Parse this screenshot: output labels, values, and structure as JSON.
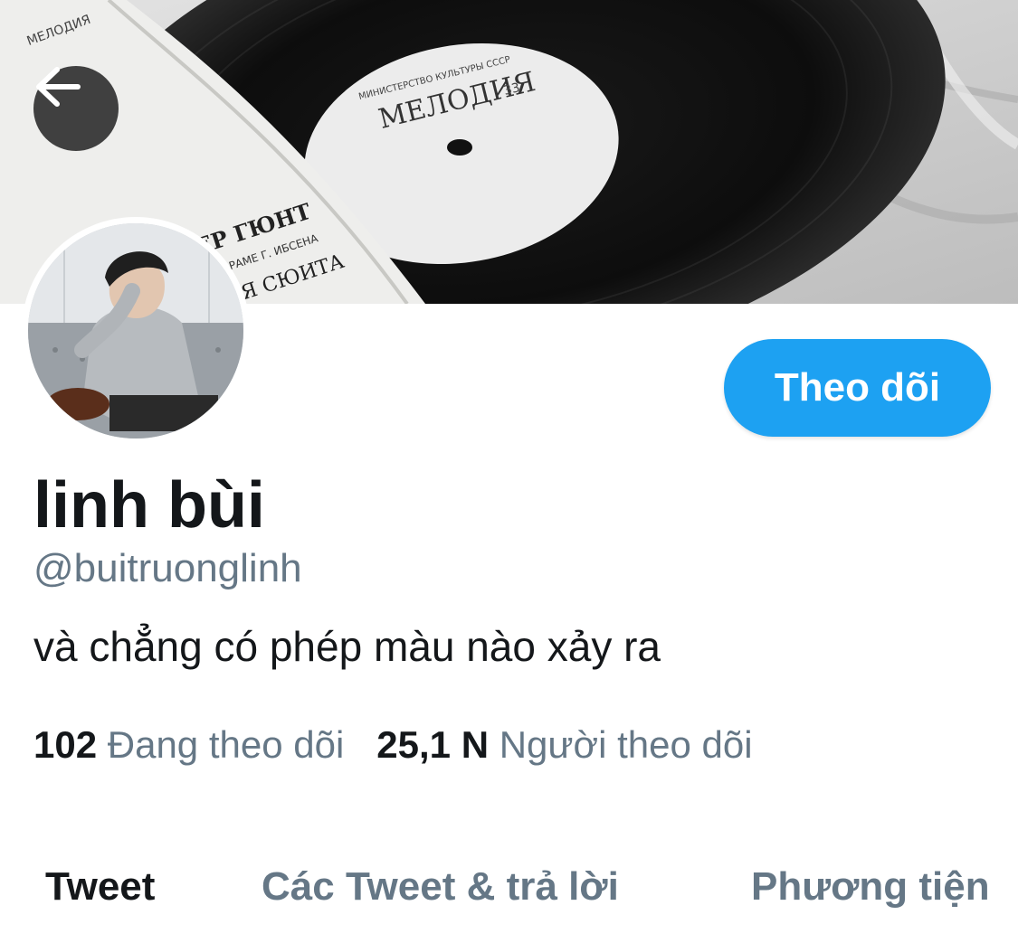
{
  "banner": {
    "record_label_text": "МЕЛОДИЯ",
    "sleeve_line1": "ЕР ГЮНТ",
    "sleeve_line2": "К ДРАМЕ Г. ИБСЕНА",
    "sleeve_line3": "Я СЮИТА",
    "label_top_text": "МИНИСТЕРСТВО КУЛЬТУРЫ СССР",
    "label_side_text": "33",
    "sleeve_top_text": "МЕЛОДИЯ"
  },
  "profile": {
    "display_name": "linh bùi",
    "handle": "@buitruonglinh",
    "bio": "và chẳng có phép màu nào xảy ra",
    "following_count": "102",
    "following_label": "Đang theo dõi",
    "followers_count": "25,1 N",
    "followers_label": "Người theo dõi"
  },
  "actions": {
    "follow_label": "Theo dõi"
  },
  "tabs": [
    {
      "label": "Tweet",
      "active": true
    },
    {
      "label": "Các Tweet & trả lời",
      "active": false
    },
    {
      "label": "Phương tiện",
      "active": false
    }
  ],
  "colors": {
    "accent": "#1da1f2",
    "secondary_text": "#657786",
    "primary_text": "#14171a"
  },
  "icons": {
    "back": "arrow-left-icon"
  }
}
